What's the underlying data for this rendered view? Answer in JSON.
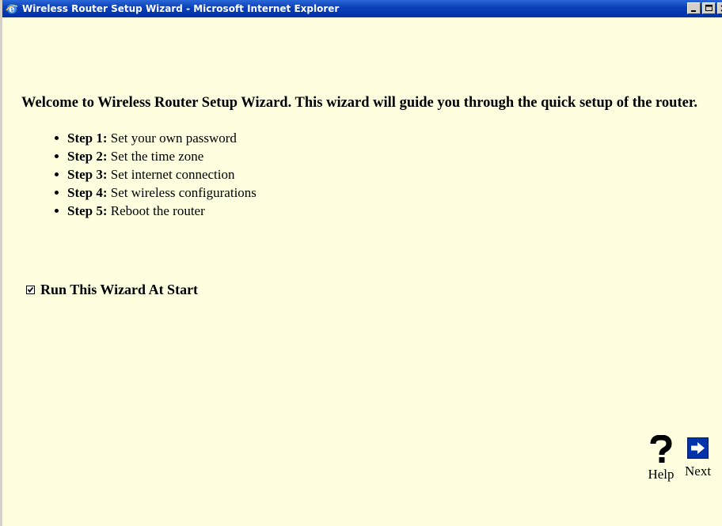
{
  "window": {
    "title": "Wireless Router Setup Wizard - Microsoft Internet Explorer"
  },
  "welcome_text": "Welcome to Wireless Router Setup Wizard. This wizard will guide you through the quick setup of the router.",
  "steps": [
    {
      "label": "Step 1:",
      "text": "Set your own password"
    },
    {
      "label": "Step 2:",
      "text": "Set the time zone"
    },
    {
      "label": "Step 3:",
      "text": "Set internet connection"
    },
    {
      "label": "Step 4:",
      "text": "Set wireless configurations"
    },
    {
      "label": "Step 5:",
      "text": "Reboot the router"
    }
  ],
  "run_at_start": {
    "label": "Run This Wizard At Start",
    "checked": true
  },
  "nav": {
    "help_label": "Help",
    "next_label": "Next"
  },
  "colors": {
    "background": "#ffffe0",
    "titlebar": "#0a3fb8",
    "next_button": "#0033aa"
  },
  "icons": {
    "help": "question-mark-icon",
    "next": "right-arrow-icon",
    "app": "internet-explorer-icon"
  }
}
